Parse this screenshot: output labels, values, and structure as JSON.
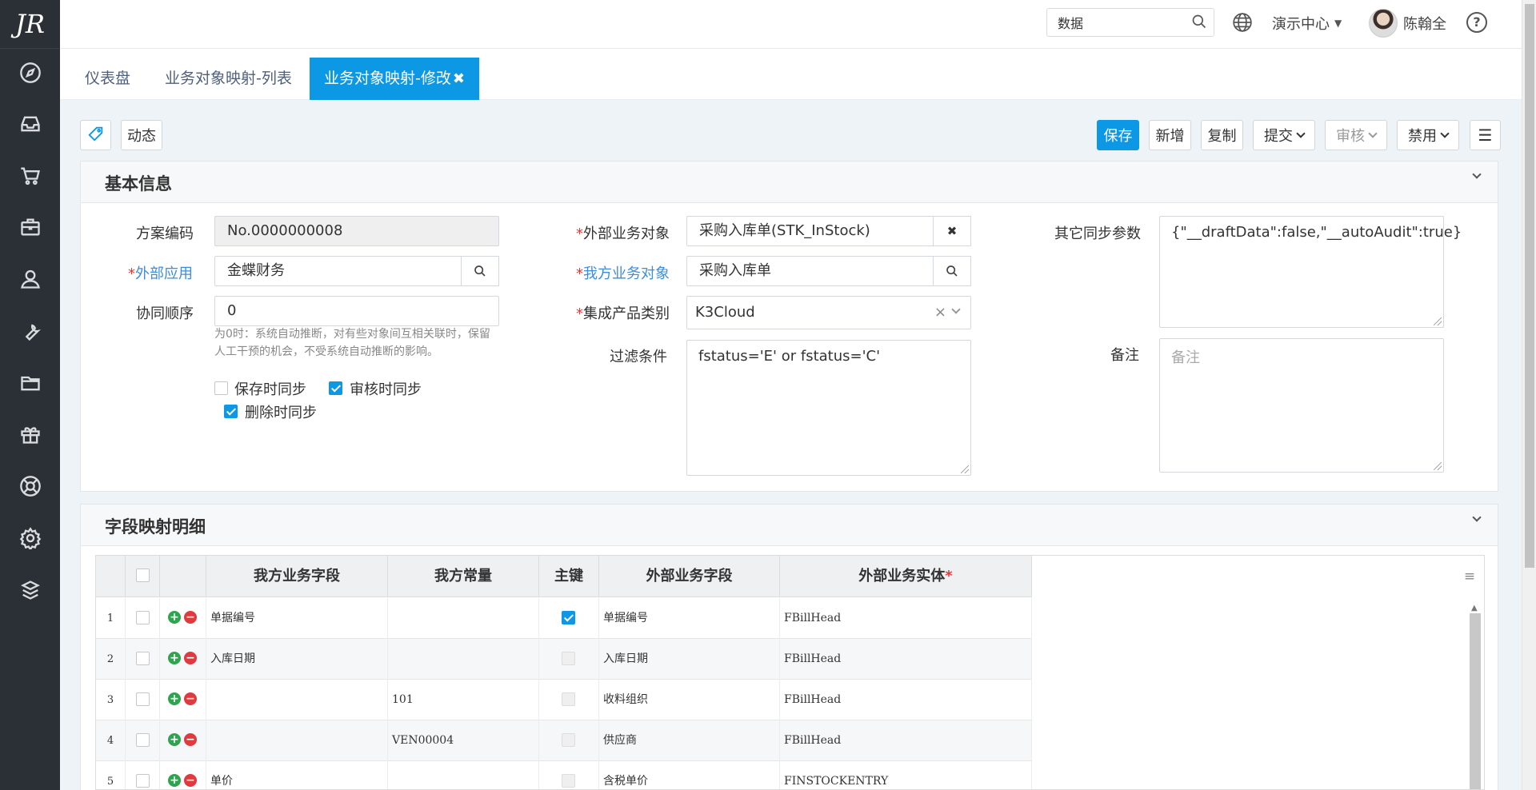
{
  "sidebar": {
    "logo": "JR",
    "items": [
      "compass-icon",
      "inbox-icon",
      "cart-icon",
      "briefcase-icon",
      "user-icon",
      "wrench-icon",
      "folder-icon",
      "gift-icon",
      "lifebuoy-icon",
      "gear-icon",
      "cube-icon"
    ]
  },
  "topbar": {
    "search_value": "数据",
    "demo_center": "演示中心",
    "username": "陈翰全",
    "help": "?"
  },
  "tabs": [
    {
      "label": "仪表盘"
    },
    {
      "label": "业务对象映射-列表"
    },
    {
      "label": "业务对象映射-修改",
      "active": true,
      "close": "✖"
    }
  ],
  "toolbar": {
    "dynamic_label": "动态",
    "save": "保存",
    "add": "新增",
    "copy": "复制",
    "submit": "提交",
    "audit": "审核",
    "disable": "禁用"
  },
  "basic": {
    "title": "基本信息",
    "plan_code_label": "方案编码",
    "plan_code": "No.0000000008",
    "ext_app_label": "外部应用",
    "ext_app": "金蝶财务",
    "order_label": "协同顺序",
    "order": "0",
    "order_hint": "为0时：系统自动推断，对有些对象间互相关联时，保留人工干预的机会，不受系统自动推断的影响。",
    "ext_obj_label": "外部业务对象",
    "ext_obj": "采购入库单(STK_InStock)",
    "my_obj_label": "我方业务对象",
    "my_obj": "采购入库单",
    "product_label": "集成产品类别",
    "product": "K3Cloud",
    "filter_label": "过滤条件",
    "filter": "fstatus='E' or fstatus='C'",
    "other_label": "其它同步参数",
    "other": "{\"__draftData\":false,\"__autoAudit\":true}",
    "remark_label": "备注",
    "remark_placeholder": "备注",
    "sync_save": "保存时同步",
    "sync_audit": "审核时同步",
    "sync_delete": "删除时同步",
    "required_mark": "*"
  },
  "mapping": {
    "title": "字段映射明细",
    "columns": [
      "我方业务字段",
      "我方常量",
      "主键",
      "外部业务字段",
      "外部业务实体"
    ],
    "rows": [
      {
        "n": "1",
        "my_field": "单据编号",
        "const": "",
        "key": true,
        "ext_field": "单据编号",
        "entity": "FBillHead"
      },
      {
        "n": "2",
        "my_field": "入库日期",
        "const": "",
        "key": false,
        "ext_field": "入库日期",
        "entity": "FBillHead"
      },
      {
        "n": "3",
        "my_field": "",
        "const": "101",
        "key": false,
        "ext_field": "收料组织",
        "entity": "FBillHead"
      },
      {
        "n": "4",
        "my_field": "",
        "const": "VEN00004",
        "key": false,
        "ext_field": "供应商",
        "entity": "FBillHead"
      },
      {
        "n": "5",
        "my_field": "单价",
        "const": "",
        "key": false,
        "ext_field": "含税单价",
        "entity": "FINSTOCKENTRY"
      }
    ]
  }
}
